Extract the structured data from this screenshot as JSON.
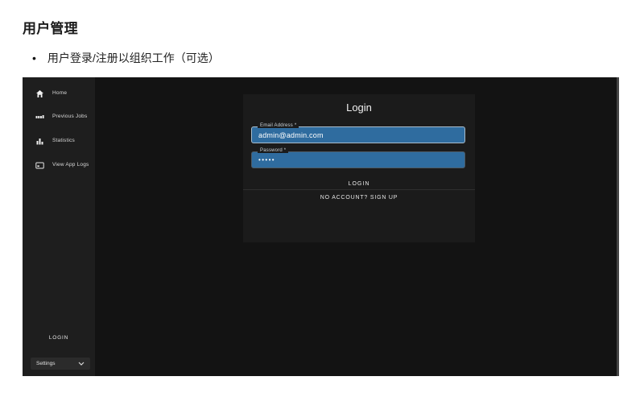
{
  "doc": {
    "title": "用户管理",
    "bullet": "用户登录/注册以组织工作（可选）"
  },
  "app": {
    "sidebar": {
      "items": [
        {
          "label": "Home",
          "icon": "home-icon"
        },
        {
          "label": "Previous Jobs",
          "icon": "previous-jobs-icon"
        },
        {
          "label": "Statistics",
          "icon": "statistics-icon"
        },
        {
          "label": "View App Logs",
          "icon": "app-logs-icon"
        }
      ],
      "login_label": "LOGIN",
      "settings": {
        "label": "Settings",
        "icon": "chevron-down-icon"
      }
    },
    "login_card": {
      "title": "Login",
      "email": {
        "label": "Email Address *",
        "value": "admin@admin.com"
      },
      "password": {
        "label": "Password *",
        "value": "•••••"
      },
      "submit_label": "LOGIN",
      "signup_label": "NO ACCOUNT? SIGN UP"
    },
    "colors": {
      "autofill_field_blue": "#2f6c9f",
      "sidebar_bg": "#1e1e1e",
      "main_bg": "#131313",
      "card_bg": "#1b1b1b"
    }
  }
}
